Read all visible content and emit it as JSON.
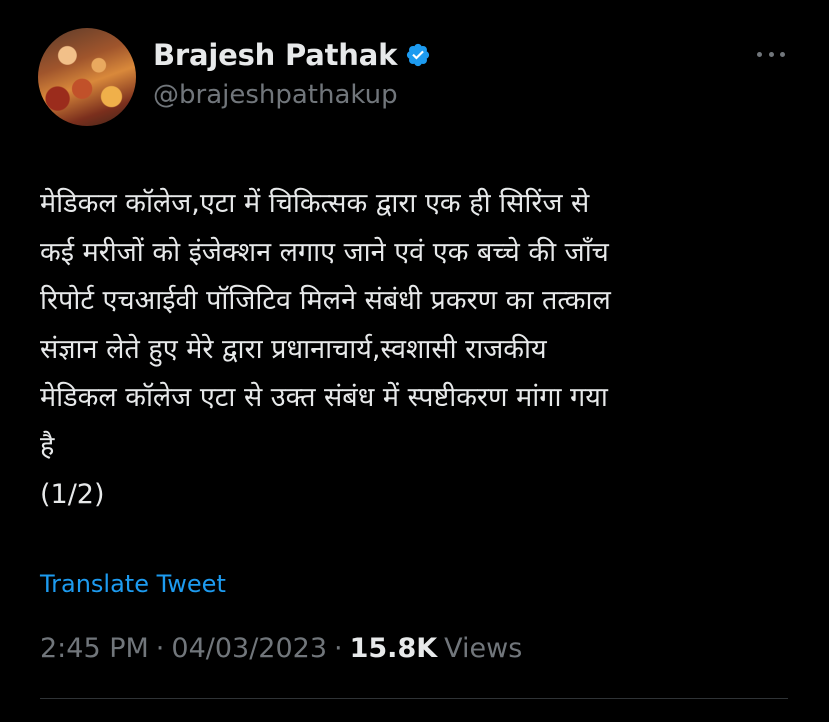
{
  "author": {
    "display_name": "Brajesh Pathak",
    "handle": "@brajeshpathakup",
    "verified": true
  },
  "tweet": {
    "text": "मेडिकल कॉलेज,एटा में चिकित्सक द्वारा एक ही सिरिंज से\nकई मरीजों को इंजेक्शन लगाए जाने एवं एक बच्चे की जाँच\nरिपोर्ट एचआईवी पॉजिटिव मिलने संबंधी प्रकरण का तत्काल\nसंज्ञान लेते हुए मेरे द्वारा प्रधानाचार्य,स्वशासी राजकीय\nमेडिकल कॉलेज एटा से उक्त संबंध में स्पष्टीकरण मांगा गया\nहै\n(1/2)",
    "translate_label": "Translate Tweet",
    "time": "2:45 PM",
    "date": "04/03/2023",
    "separator": "·",
    "views_count": "15.8K",
    "views_label": "Views"
  },
  "icons": {
    "verified": "verified-badge-icon",
    "more": "more-options-icon",
    "avatar": "profile-photo"
  },
  "colors": {
    "background": "#000000",
    "primary_text": "#e7e9ea",
    "secondary_text": "#71767b",
    "link": "#1d9bf0",
    "verified_badge": "#1d9bf0"
  }
}
